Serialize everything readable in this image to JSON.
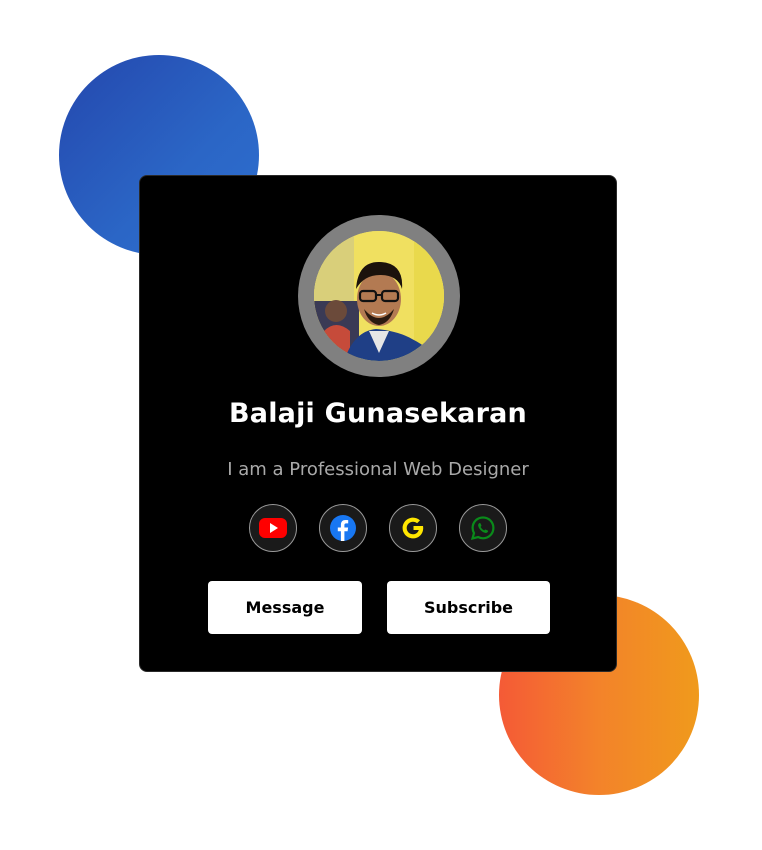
{
  "profile": {
    "name": "Balaji Gunasekaran",
    "role": "I am a Professional Web Designer"
  },
  "socials": [
    {
      "icon": "youtube-icon",
      "color": "#ff0000"
    },
    {
      "icon": "facebook-icon",
      "color": "#1877f2"
    },
    {
      "icon": "google-icon",
      "color": "#ffe600"
    },
    {
      "icon": "whatsapp-icon",
      "color": "#0a8a1a"
    }
  ],
  "buttons": {
    "message_label": "Message",
    "subscribe_label": "Subscribe"
  },
  "colors": {
    "card_background": "#000000",
    "blue_circle": "#2b66c6",
    "orange_circle": "#f3832a",
    "avatar_ring": "#808080"
  }
}
